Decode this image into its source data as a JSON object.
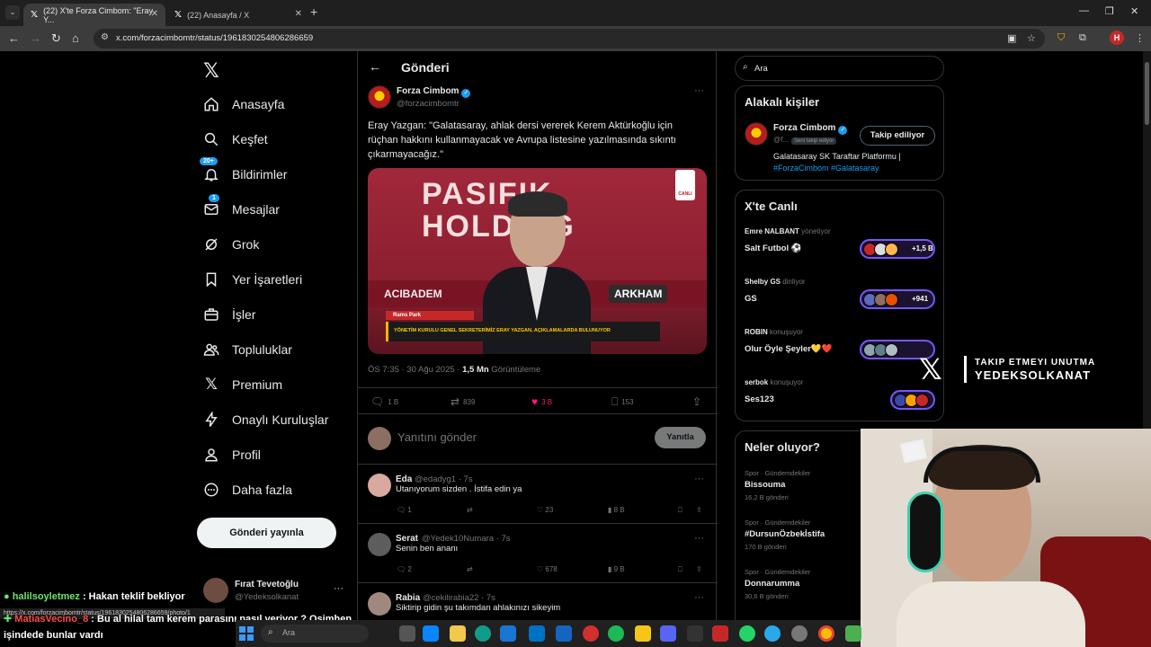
{
  "browser": {
    "tabs": [
      {
        "label": "(22) X'te Forza Cimbom: \"Eray Y...",
        "active": true
      },
      {
        "label": "(22) Anasayfa / X",
        "active": false
      }
    ],
    "url": "x.com/forzacimbomtr/status/1961830254806286659",
    "profile_initial": "H",
    "status_url": "https://x.com/forzacimbomtr/status/1961830254806286659/photo/1"
  },
  "sidebar": {
    "items": [
      {
        "label": "Anasayfa",
        "icon": "home-icon"
      },
      {
        "label": "Keşfet",
        "icon": "search-icon"
      },
      {
        "label": "Bildirimler",
        "icon": "bell-icon",
        "badge": "20+"
      },
      {
        "label": "Mesajlar",
        "icon": "mail-icon",
        "badge": "1"
      },
      {
        "label": "Grok",
        "icon": "grok-icon"
      },
      {
        "label": "Yer İşaretleri",
        "icon": "bookmark-icon"
      },
      {
        "label": "İşler",
        "icon": "briefcase-icon"
      },
      {
        "label": "Topluluklar",
        "icon": "people-icon"
      },
      {
        "label": "Premium",
        "icon": "x-logo-icon"
      },
      {
        "label": "Onaylı Kuruluşlar",
        "icon": "lightning-icon"
      },
      {
        "label": "Profil",
        "icon": "person-icon"
      },
      {
        "label": "Daha fazla",
        "icon": "more-circle-icon"
      }
    ],
    "post_button": "Gönderi yayınla",
    "me": {
      "name": "Fırat Tevetoğlu",
      "handle": "@Yedeksolkanat"
    }
  },
  "main": {
    "title": "Gönderi",
    "tweet": {
      "name": "Forza Cimbom",
      "handle": "@forzacimbomtr",
      "text": "Eray Yazgan: \"Galatasaray, ahlak dersi vererek Kerem Aktürkoğlu için rüçhan hakkını kullanmayacak ve Avrupa listesine yazılmasında sıkıntı çıkarmayacağız.\"",
      "media": {
        "sponsor_top": "PASIFIK",
        "sponsor_bottom": "HOLDING",
        "sponsor_left": "ACIBADEM",
        "sponsor_right": "ARKHAM",
        "live_label": "CANLI",
        "location": "Rams Park",
        "lower_third": "YÖNETİM KURULU GENEL SEKRETERİMİZ ERAY YAZGAN, AÇIKLAMALARDA BULUNUYOR"
      },
      "time": "ÖS 7:35 · 30 Ağu 2025 · ",
      "views": "1,5 Mn",
      "views_label": " Görüntüleme",
      "stats": {
        "replies": "1 B",
        "retweets": "839",
        "likes": "3 B",
        "bookmarks": "153"
      }
    },
    "reply_placeholder": "Yanıtını gönder",
    "reply_button": "Yanıtla",
    "replies": [
      {
        "name": "Eda",
        "handle": "@edadyg1 · 7s",
        "text": "Utanıyorum sizden . İstifa edin ya",
        "stats": {
          "replies": "1",
          "likes": "23",
          "views": "8 B"
        }
      },
      {
        "name": "Serat",
        "handle": "@Yedek10Numara · 7s",
        "text": "Senin ben ananı",
        "stats": {
          "replies": "2",
          "likes": "678",
          "views": "9 B"
        }
      },
      {
        "name": "Rabia",
        "handle": "@cekilirabia22 · 7s",
        "text": "Siktirip gidin şu takımdan ahlakınızı sikeyim"
      }
    ]
  },
  "right": {
    "search_placeholder": "Ara",
    "relevant": {
      "title": "Alakalı kişiler",
      "name": "Forza Cimbom",
      "handle": "@f...",
      "follows_you": "Seni takip ediyor",
      "follow_button": "Takip ediliyor",
      "bio": "Galatasaray SK Taraftar Platformu | ",
      "tags": "#ForzaCimbom #Galatasaray"
    },
    "live": {
      "title": "X'te Canlı",
      "items": [
        {
          "host": "Emre NALBANT",
          "role": "yönetiyor",
          "title": "Salt Futbol ⚽",
          "count": "+1,5 B"
        },
        {
          "host": "Shelby GS",
          "role": "dinliyor",
          "title": "GS",
          "count": "+941"
        },
        {
          "host": "ROBIN",
          "role": "konuşuyor",
          "title": "Olur Öyle Şeyler💛❤️",
          "count": ""
        },
        {
          "host": "serbok",
          "role": "konuşuyor",
          "title": "Ses123",
          "count": ""
        }
      ]
    },
    "trends": {
      "title": "Neler oluyor?",
      "items": [
        {
          "category": "Spor · Gündemdekiler",
          "name": "Bissouma",
          "count": "16,2 B gönderi"
        },
        {
          "category": "Spor · Gündemdekiler",
          "name": "#DursunÖzbekİstifa",
          "count": "170 B gönderi"
        },
        {
          "category": "Spor · Gündemdekiler",
          "name": "Donnarumma",
          "count": "30,6 B gönderi"
        }
      ]
    }
  },
  "overlay": {
    "line1": "TAKIP ETMEYI UNUTMA",
    "line2": "YEDEKSOLKANAT"
  },
  "chat": [
    {
      "user": "halilsoyletmez",
      "text": " : Hakan teklif bekliyor"
    },
    {
      "user": "MatiasVecino_8",
      "text": " : Bu al hilal tam kerem parasını nasıl veriyor ? Osimhen"
    },
    {
      "user": "",
      "text": "işindede bunlar vardı"
    }
  ],
  "taskbar": {
    "search": "Ara",
    "ticker": "USD/TRY"
  }
}
